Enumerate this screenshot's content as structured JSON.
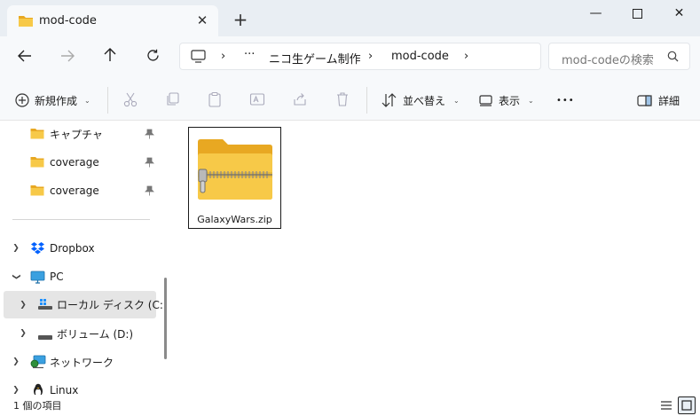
{
  "window": {
    "tab_title": "mod-code",
    "close_tab": "✕",
    "new_tab": "+",
    "minimize": "—",
    "maximize": "☐",
    "close": "✕"
  },
  "address": {
    "ellipsis": "···",
    "sep": "›",
    "crumbs": [
      "ニコ生ゲーム制作",
      "mod-code"
    ],
    "search_placeholder": "mod-codeの検索"
  },
  "toolbar": {
    "new_label": "新規作成",
    "sort_label": "並べ替え",
    "view_label": "表示",
    "more_label": "•••",
    "details_label": "詳細"
  },
  "sidebar": {
    "quick_access": [
      {
        "label": "キャプチャ"
      },
      {
        "label": "coverage"
      },
      {
        "label": "coverage"
      }
    ],
    "dropbox": "Dropbox",
    "pc": "PC",
    "local_disk": "ローカル ディスク (C:)",
    "volume_d": "ボリューム (D:)",
    "network": "ネットワーク",
    "linux": "Linux"
  },
  "files": [
    {
      "name": "GalaxyWars.zip"
    }
  ],
  "status": {
    "item_count": "1 個の項目"
  },
  "colors": {
    "folder": "#f7c948",
    "folder_dark": "#e8a822",
    "selected_bg": "#e5e5e5",
    "titlebar_bg": "#e9eef3"
  }
}
